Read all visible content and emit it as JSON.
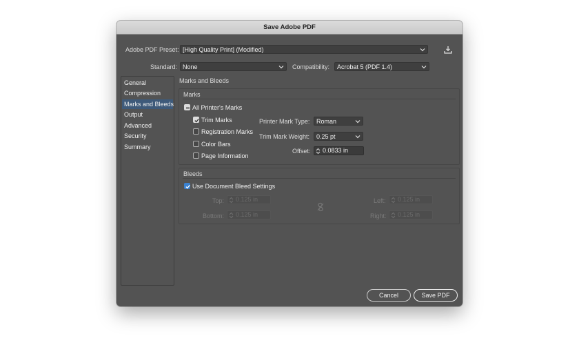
{
  "dialog": {
    "title": "Save Adobe PDF",
    "preset_label": "Adobe PDF Preset:",
    "preset_value": "[High Quality Print] (Modified)",
    "save_preset_icon": "download-icon",
    "standard_label": "Standard:",
    "standard_value": "None",
    "compat_label": "Compatibility:",
    "compat_value": "Acrobat 5 (PDF 1.4)"
  },
  "sidebar": {
    "items": [
      {
        "label": "General"
      },
      {
        "label": "Compression"
      },
      {
        "label": "Marks and Bleeds",
        "selected": true
      },
      {
        "label": "Output"
      },
      {
        "label": "Advanced"
      },
      {
        "label": "Security"
      },
      {
        "label": "Summary"
      }
    ]
  },
  "panel": {
    "title": "Marks and Bleeds",
    "marks": {
      "title": "Marks",
      "all_printers_marks": "All Printer's Marks",
      "trim_marks": "Trim Marks",
      "registration_marks": "Registration Marks",
      "color_bars": "Color Bars",
      "page_information": "Page Information",
      "printer_mark_type_label": "Printer Mark Type:",
      "printer_mark_type_value": "Roman",
      "trim_mark_weight_label": "Trim Mark Weight:",
      "trim_mark_weight_value": "0.25 pt",
      "offset_label": "Offset:",
      "offset_value": "0.0833 in"
    },
    "bleeds": {
      "title": "Bleeds",
      "use_doc_bleed": "Use Document Bleed Settings",
      "top_label": "Top:",
      "top_value": "0.125 in",
      "bottom_label": "Bottom:",
      "bottom_value": "0.125 in",
      "left_label": "Left:",
      "left_value": "0.125 in",
      "right_label": "Right:",
      "right_value": "0.125 in",
      "link_icon": "link-icon"
    }
  },
  "buttons": {
    "cancel": "Cancel",
    "save": "Save PDF"
  },
  "colors": {
    "dialog_bg": "#535353",
    "selection": "#3e5a7a",
    "checkbox_accent": "#3b82d1"
  }
}
